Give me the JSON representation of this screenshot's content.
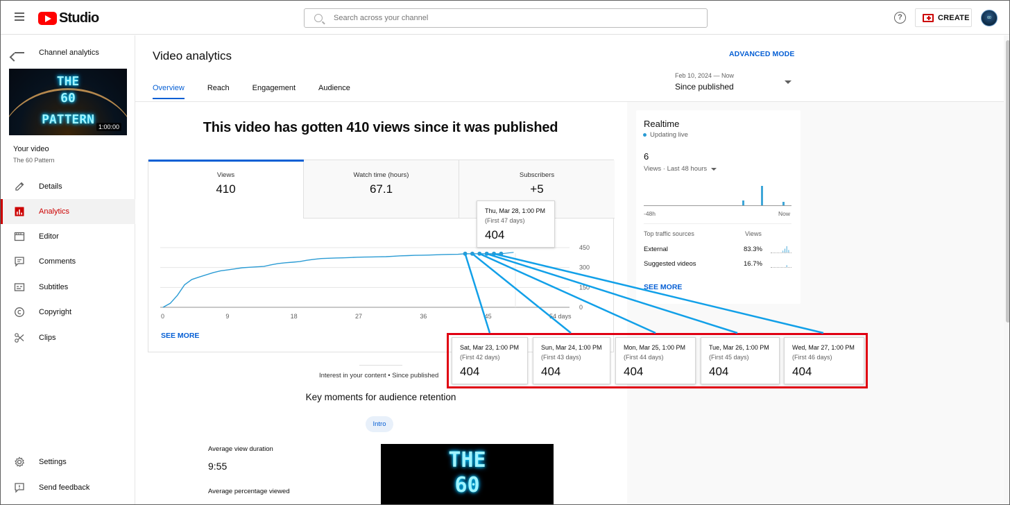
{
  "header": {
    "logo_text": "Studio",
    "search_placeholder": "Search across your channel",
    "create_label": "CREATE",
    "help_glyph": "?",
    "avatar_text": "60"
  },
  "sidebar": {
    "back_label": "Channel analytics",
    "thumbnail": {
      "line1": "THE",
      "line2": "60",
      "line3": "PATTERN",
      "duration": "1:00:00"
    },
    "your_video_label": "Your video",
    "video_title": "The 60 Pattern",
    "items": [
      {
        "label": "Details",
        "icon": "pencil-icon"
      },
      {
        "label": "Analytics",
        "icon": "analytics-icon",
        "active": true
      },
      {
        "label": "Editor",
        "icon": "editor-icon"
      },
      {
        "label": "Comments",
        "icon": "comments-icon"
      },
      {
        "label": "Subtitles",
        "icon": "subtitles-icon"
      },
      {
        "label": "Copyright",
        "icon": "copyright-icon"
      },
      {
        "label": "Clips",
        "icon": "scissors-icon"
      }
    ],
    "bottom_items": [
      {
        "label": "Settings",
        "icon": "gear-icon"
      },
      {
        "label": "Send feedback",
        "icon": "feedback-icon"
      }
    ]
  },
  "main": {
    "title": "Video analytics",
    "advanced_mode": "ADVANCED MODE",
    "tabs": [
      "Overview",
      "Reach",
      "Engagement",
      "Audience"
    ],
    "date_range": "Feb 10, 2024 — Now",
    "date_value": "Since published",
    "headline": "This video has gotten 410 views since it was published",
    "metrics": [
      {
        "label": "Views",
        "value": "410"
      },
      {
        "label": "Watch time (hours)",
        "value": "67.1"
      },
      {
        "label": "Subscribers",
        "value": "+5"
      }
    ],
    "see_more": "SEE MORE",
    "interest_line": "Interest in your content • Since published",
    "key_moments_title": "Key moments for audience retention",
    "intro_chip": "Intro",
    "avg_view_duration_label": "Average view duration",
    "avg_view_duration_value": "9:55",
    "avg_percentage_label": "Average percentage viewed"
  },
  "tooltip_main": {
    "date": "Thu, Mar 28, 1:00 PM",
    "sub": "(First 47 days)",
    "value": "404"
  },
  "tooltips": [
    {
      "date": "Sat, Mar 23, 1:00 PM",
      "sub": "(First 42 days)",
      "value": "404"
    },
    {
      "date": "Sun, Mar 24, 1:00 PM",
      "sub": "(First 43 days)",
      "value": "404"
    },
    {
      "date": "Mon, Mar 25, 1:00 PM",
      "sub": "(First 44 days)",
      "value": "404"
    },
    {
      "date": "Tue, Mar 26, 1:00 PM",
      "sub": "(First 45 days)",
      "value": "404"
    },
    {
      "date": "Wed, Mar 27, 1:00 PM",
      "sub": "(First 46 days)",
      "value": "404"
    }
  ],
  "realtime": {
    "title": "Realtime",
    "live": "Updating live",
    "count": "6",
    "sub": "Views · Last 48 hours",
    "left_label": "-48h",
    "right_label": "Now",
    "bars": [
      0.2,
      0.82,
      0.16
    ],
    "traffic_header": "Top traffic sources",
    "traffic_views_header": "Views",
    "sources": [
      {
        "name": "External",
        "pct": "83.3%"
      },
      {
        "name": "Suggested videos",
        "pct": "16.7%"
      }
    ],
    "see_more": "SEE MORE"
  },
  "colors": {
    "accent": "#065fd4",
    "line": "#2a9bd4",
    "brand": "#ff0000",
    "highlight": "#e00012"
  },
  "chart_data": {
    "type": "line",
    "title": "",
    "xlabel": "",
    "ylabel": "",
    "x_ticks": [
      "0",
      "9",
      "18",
      "27",
      "36",
      "45",
      "54 days"
    ],
    "y_ticks": [
      "0",
      "150",
      "300",
      "450"
    ],
    "xlim": [
      0,
      54
    ],
    "ylim": [
      0,
      450
    ],
    "series": [
      {
        "x": [
          0,
          1,
          2,
          3,
          4,
          5,
          6,
          7,
          8,
          9,
          10,
          11,
          12,
          13,
          14,
          15,
          16,
          17,
          18,
          19,
          20,
          21,
          22,
          23,
          24,
          25,
          26,
          27,
          28,
          29,
          30,
          31,
          32,
          33,
          34,
          35,
          36,
          37,
          38,
          39,
          40,
          41,
          42,
          43,
          44,
          45,
          46,
          47
        ],
        "y": [
          0,
          30,
          90,
          170,
          210,
          228,
          245,
          262,
          275,
          282,
          290,
          298,
          302,
          305,
          308,
          320,
          330,
          336,
          340,
          345,
          355,
          362,
          368,
          370,
          372,
          373,
          375,
          378,
          379,
          380,
          381,
          382,
          385,
          388,
          390,
          392,
          393,
          394,
          396,
          398,
          399,
          400,
          404,
          404,
          404,
          404,
          404,
          404
        ]
      }
    ]
  }
}
